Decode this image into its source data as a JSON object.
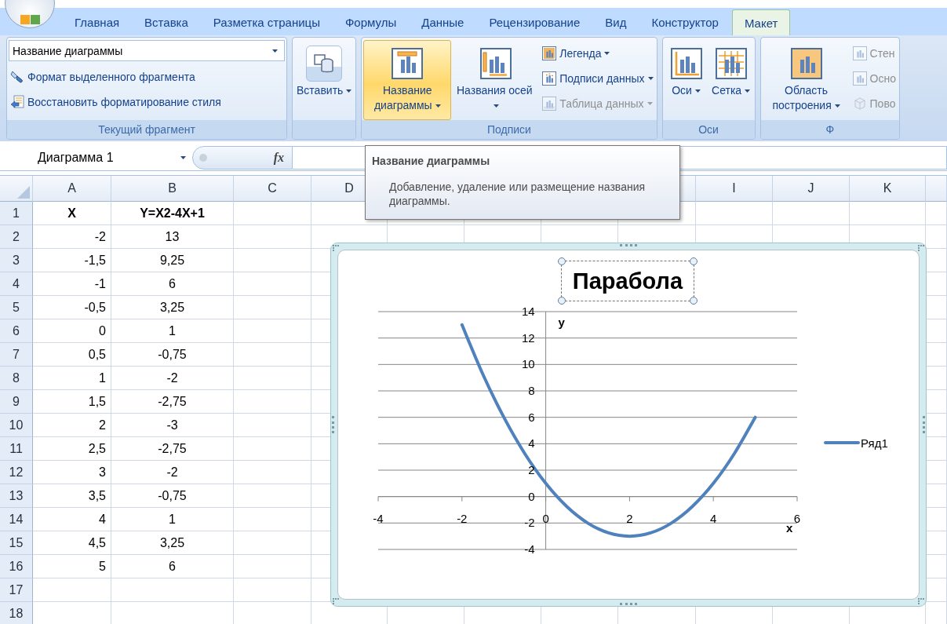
{
  "tabs": [
    {
      "label": "Главная",
      "selected": false
    },
    {
      "label": "Вставка",
      "selected": false
    },
    {
      "label": "Разметка страницы",
      "selected": false
    },
    {
      "label": "Формулы",
      "selected": false
    },
    {
      "label": "Данные",
      "selected": false
    },
    {
      "label": "Рецензирование",
      "selected": false
    },
    {
      "label": "Вид",
      "selected": false
    },
    {
      "label": "Конструктор",
      "selected": false
    },
    {
      "label": "Макет",
      "selected": true
    }
  ],
  "ribbon_groups": [
    {
      "label": "Текущий фрагмент",
      "dropdown": {
        "value": "Название диаграммы"
      },
      "items": [
        {
          "kind": "small",
          "label": "Формат выделенного фрагмента",
          "menu": false,
          "disabled": false
        },
        {
          "kind": "small",
          "label": "Восстановить форматирование стиля",
          "menu": false,
          "disabled": false
        }
      ]
    },
    {
      "items": [
        {
          "kind": "big",
          "label": "Вставить",
          "menu": true,
          "highlighted": false,
          "disabled": false
        }
      ]
    },
    {
      "label": "Подписи",
      "items": [
        {
          "kind": "big",
          "label": "Название диаграммы",
          "menu": true,
          "highlighted": true,
          "disabled": false
        },
        {
          "kind": "big",
          "label": "Названия осей",
          "menu": true,
          "highlighted": false,
          "disabled": false
        },
        {
          "kind": "small",
          "label": "Легенда",
          "menu": true,
          "disabled": false
        },
        {
          "kind": "small",
          "label": "Подписи данных",
          "menu": true,
          "disabled": false
        },
        {
          "kind": "small",
          "label": "Таблица данных",
          "menu": true,
          "disabled": true
        }
      ]
    },
    {
      "label": "Оси",
      "items": [
        {
          "kind": "big",
          "label": "Оси",
          "menu": true,
          "highlighted": false,
          "disabled": false
        },
        {
          "kind": "big",
          "label": "Сетка",
          "menu": true,
          "highlighted": false,
          "disabled": false
        }
      ]
    },
    {
      "label": "Ф",
      "items": [
        {
          "kind": "big",
          "label": "Область построения",
          "menu": true,
          "highlighted": false,
          "disabled": false
        },
        {
          "kind": "small",
          "label": "Стен",
          "menu": false,
          "disabled": true
        },
        {
          "kind": "small",
          "label": "Осно",
          "menu": false,
          "disabled": true
        },
        {
          "kind": "small",
          "label": "Пово",
          "menu": false,
          "disabled": true
        }
      ]
    }
  ],
  "formula_bar": {
    "name_box": "Диаграмма 1",
    "function_button": "fx"
  },
  "tooltip": {
    "title": "Название диаграммы",
    "text": "Добавление, удаление или размещение названия диаграммы."
  },
  "sheet": {
    "columns_left": [
      "A",
      "B",
      "C",
      "D"
    ],
    "columns_right": [
      "I",
      "J",
      "K"
    ],
    "rows": [
      {
        "number": "1",
        "bold": true,
        "cells": [
          "X",
          "Y=X2-4X+1"
        ]
      },
      {
        "number": "2",
        "bold": false,
        "cells": [
          "-2",
          "13"
        ]
      },
      {
        "number": "3",
        "bold": false,
        "cells": [
          "-1,5",
          "9,25"
        ]
      },
      {
        "number": "4",
        "bold": false,
        "cells": [
          "-1",
          "6"
        ]
      },
      {
        "number": "5",
        "bold": false,
        "cells": [
          "-0,5",
          "3,25"
        ]
      },
      {
        "number": "6",
        "bold": false,
        "cells": [
          "0",
          "1"
        ]
      },
      {
        "number": "7",
        "bold": false,
        "cells": [
          "0,5",
          "-0,75"
        ]
      },
      {
        "number": "8",
        "bold": false,
        "cells": [
          "1",
          "-2"
        ]
      },
      {
        "number": "9",
        "bold": false,
        "cells": [
          "1,5",
          "-2,75"
        ]
      },
      {
        "number": "10",
        "bold": false,
        "cells": [
          "2",
          "-3"
        ]
      },
      {
        "number": "11",
        "bold": false,
        "cells": [
          "2,5",
          "-2,75"
        ]
      },
      {
        "number": "12",
        "bold": false,
        "cells": [
          "3",
          "-2"
        ]
      },
      {
        "number": "13",
        "bold": false,
        "cells": [
          "3,5",
          "-0,75"
        ]
      },
      {
        "number": "14",
        "bold": false,
        "cells": [
          "4",
          "1"
        ]
      },
      {
        "number": "15",
        "bold": false,
        "cells": [
          "4,5",
          "3,25"
        ]
      },
      {
        "number": "16",
        "bold": false,
        "cells": [
          "5",
          "6"
        ]
      },
      {
        "number": "17"
      },
      {
        "number": "18"
      }
    ]
  },
  "chart": {
    "title_selected": true,
    "chart_data": {
      "type": "line",
      "title": "Парабола",
      "xlabel": "x",
      "ylabel": "y",
      "grid": true,
      "x": [
        -2,
        -1.5,
        -1,
        -0.5,
        0,
        0.5,
        1,
        1.5,
        2,
        2.5,
        3,
        3.5,
        4,
        4.5,
        5
      ],
      "series": [
        {
          "name": "Ряд1",
          "color": "#4f81bd",
          "values": [
            13,
            9.25,
            6,
            3.25,
            1,
            -0.75,
            -2,
            -2.75,
            -3,
            -2.75,
            -2,
            -0.75,
            1,
            3.25,
            6
          ]
        }
      ],
      "xlim": [
        -4,
        6
      ],
      "ylim": [
        -4,
        14
      ],
      "xticks": [
        -4,
        -2,
        0,
        2,
        4,
        6
      ],
      "yticks": [
        -4,
        -2,
        0,
        2,
        4,
        6,
        8,
        10,
        12,
        14
      ]
    }
  }
}
